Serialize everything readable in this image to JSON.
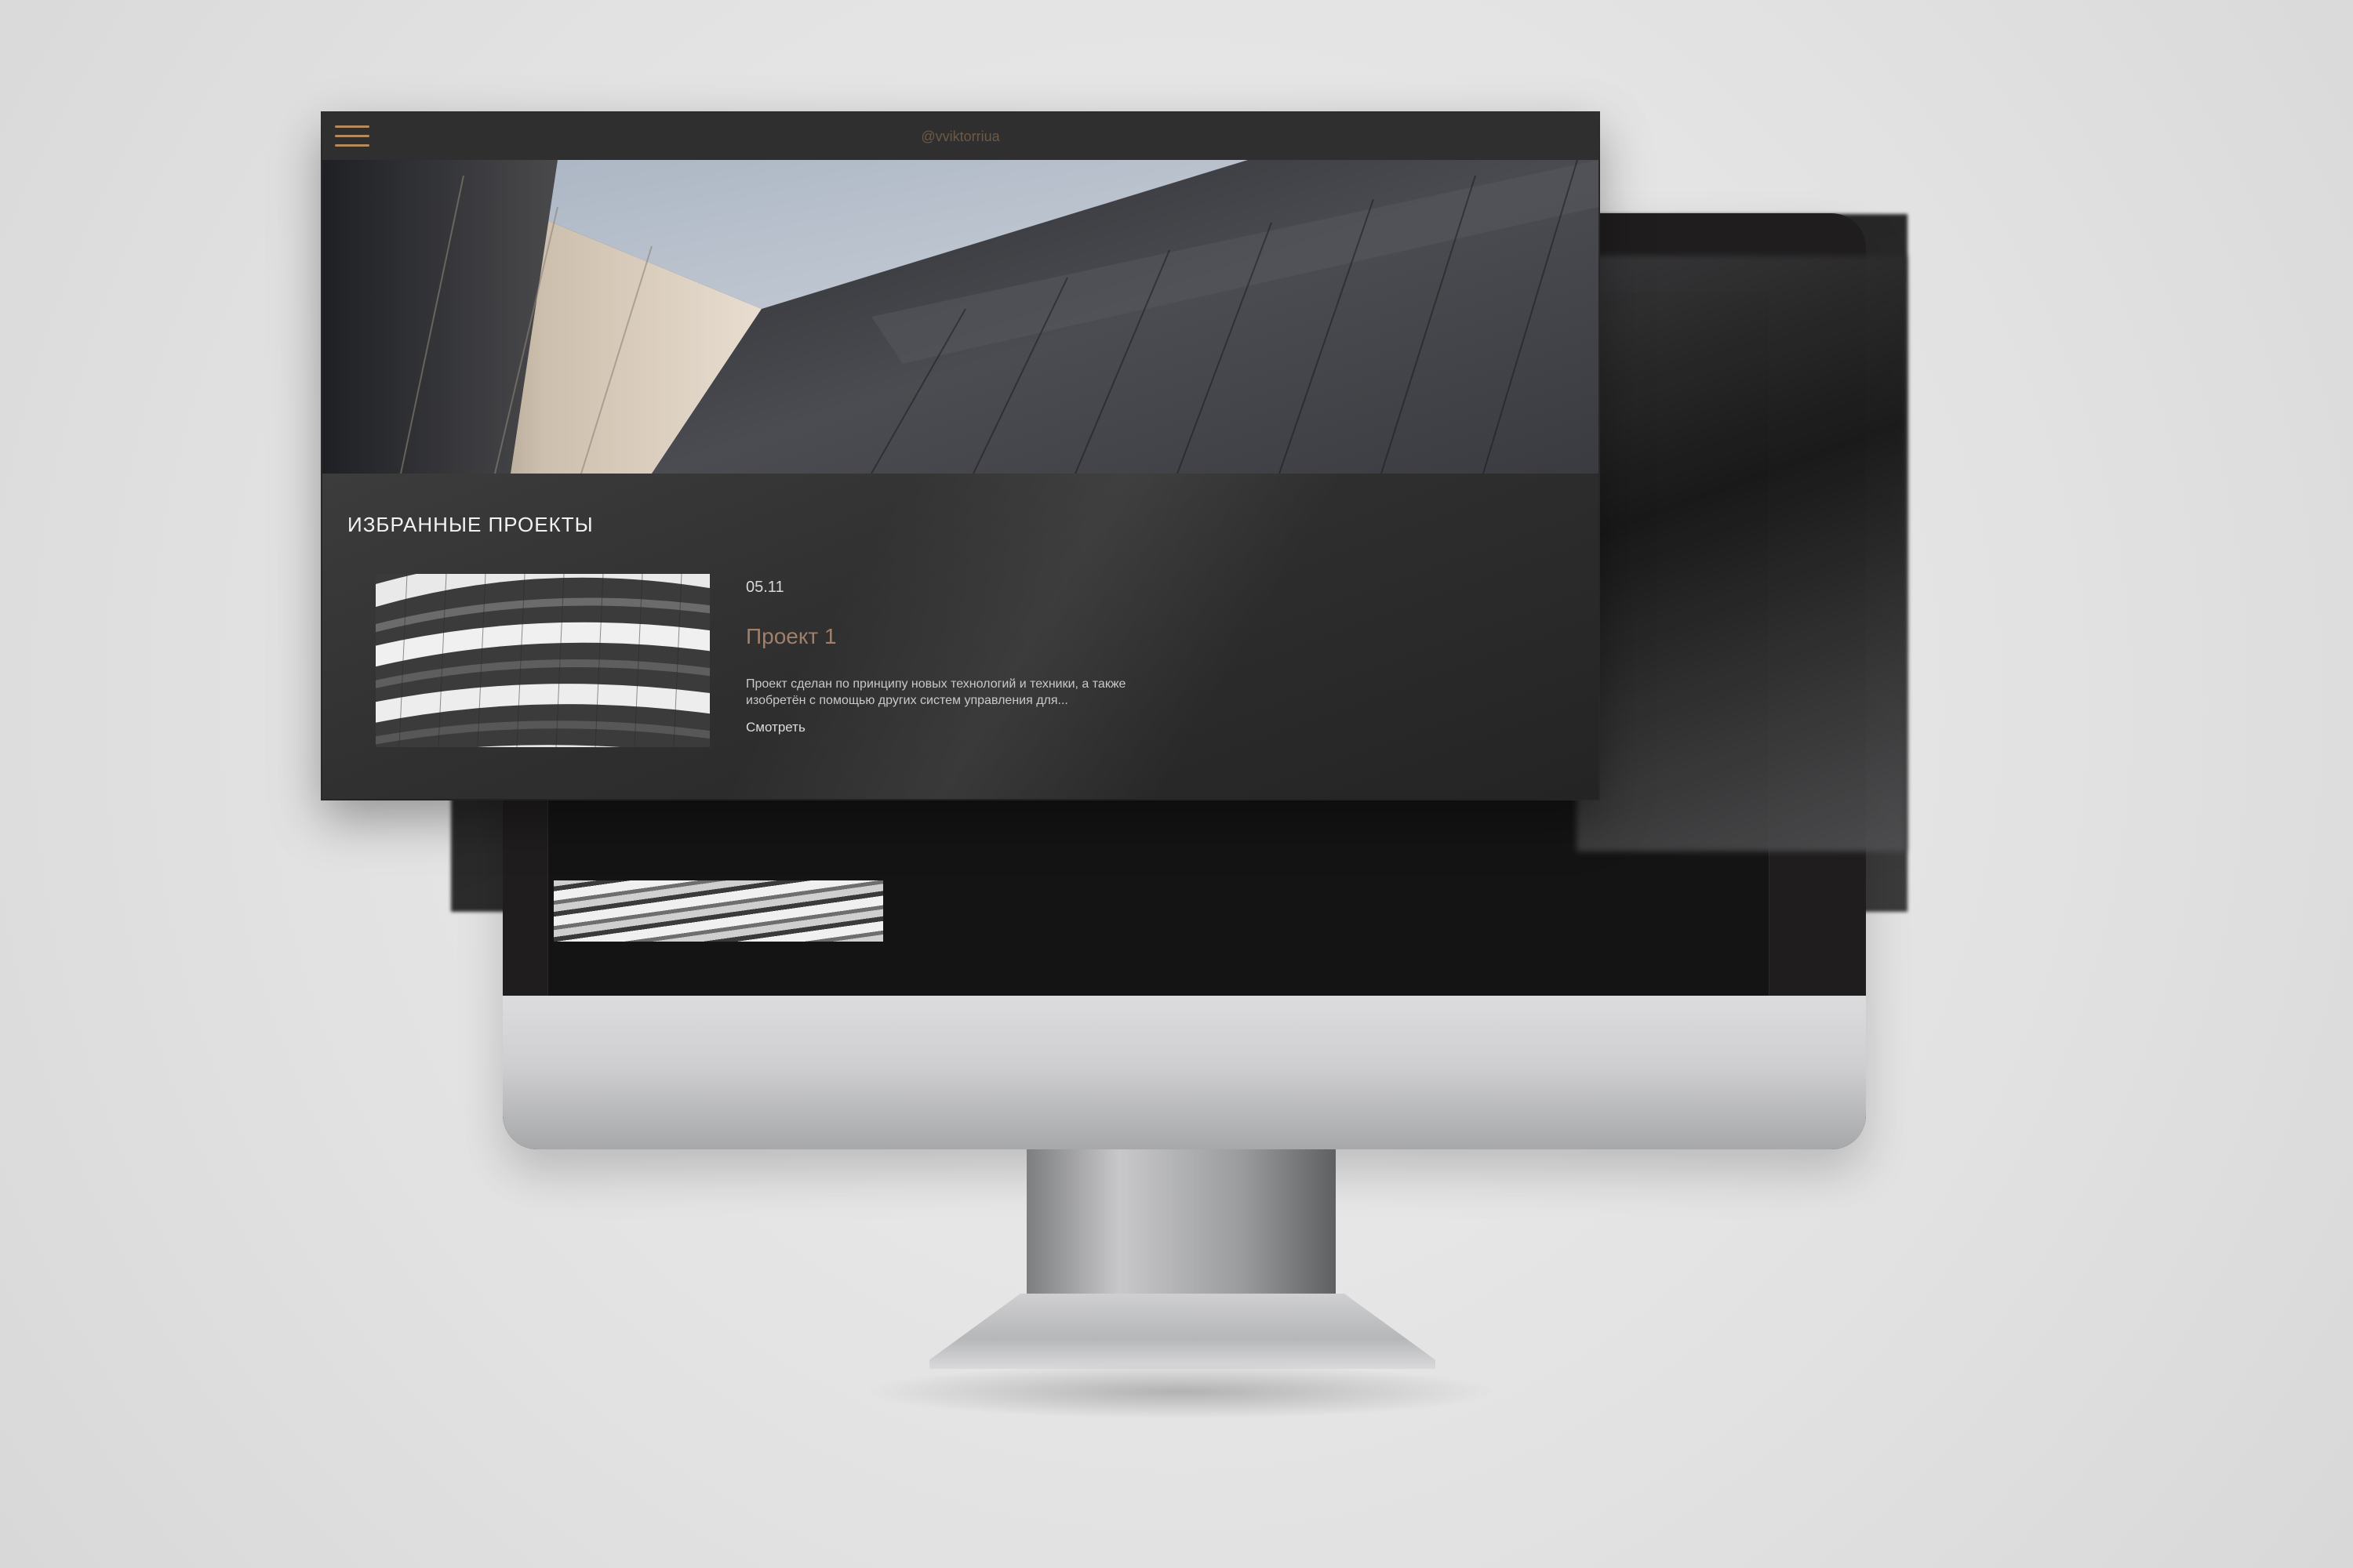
{
  "site": {
    "handle": "@vviktorriua"
  },
  "featured": {
    "title": "ИЗБРАННЫЕ ПРОЕКТЫ",
    "projects": [
      {
        "date": "05.11",
        "name": "Проект 1",
        "description": "Проект сделан по принципу новых технологий и техники, а также изобретён с помощью других систем управления для...",
        "link_label": "Смотреть"
      }
    ]
  },
  "icons": {
    "menu": "hamburger-menu-icon"
  },
  "colors": {
    "accent": "#b58a5c",
    "project_name": "#a0806a",
    "page_background": "#262626",
    "topbar": "#2f2f2f"
  }
}
